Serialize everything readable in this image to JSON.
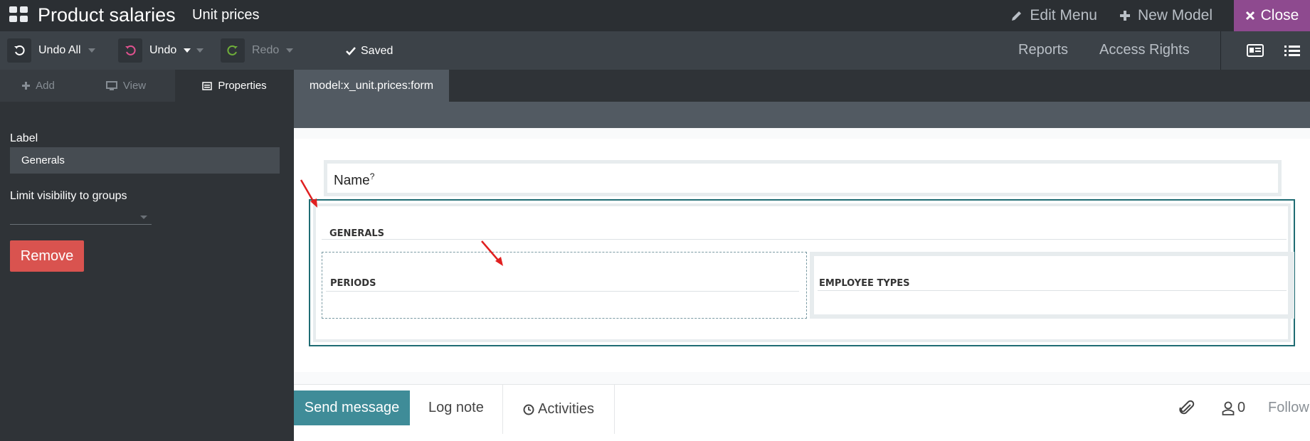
{
  "topbar": {
    "app_title": "Product salaries",
    "breadcrumb": "Unit prices",
    "edit_menu": "Edit Menu",
    "new_model": "New Model",
    "close": "Close"
  },
  "toolbar": {
    "undo_all": "Undo All",
    "undo": "Undo",
    "redo": "Redo",
    "saved": "Saved",
    "reports": "Reports",
    "access_rights": "Access Rights"
  },
  "sidebar": {
    "tabs": [
      {
        "label": "Add",
        "icon": "plus-icon"
      },
      {
        "label": "View",
        "icon": "monitor-icon"
      },
      {
        "label": "Properties",
        "icon": "properties-icon"
      }
    ],
    "label_title": "Label",
    "label_value": "Generals",
    "visibility_title": "Limit visibility to groups",
    "remove": "Remove"
  },
  "main": {
    "tab": "model:x_unit.prices:form",
    "name_field": "Name",
    "name_help": "?",
    "group_title": "GENERALS",
    "subgroups": [
      "PERIODS",
      "EMPLOYEE TYPES"
    ]
  },
  "chatter": {
    "send_message": "Send message",
    "log_note": "Log note",
    "activities": "Activities",
    "followers_count": "0",
    "follow": "Follow"
  },
  "colors": {
    "close_button": "#8e4a8f",
    "remove_button": "#d9534f",
    "send_button": "#3f8c98",
    "selected_group_border": "#1f6c73",
    "annotation_arrow": "#e02020"
  }
}
